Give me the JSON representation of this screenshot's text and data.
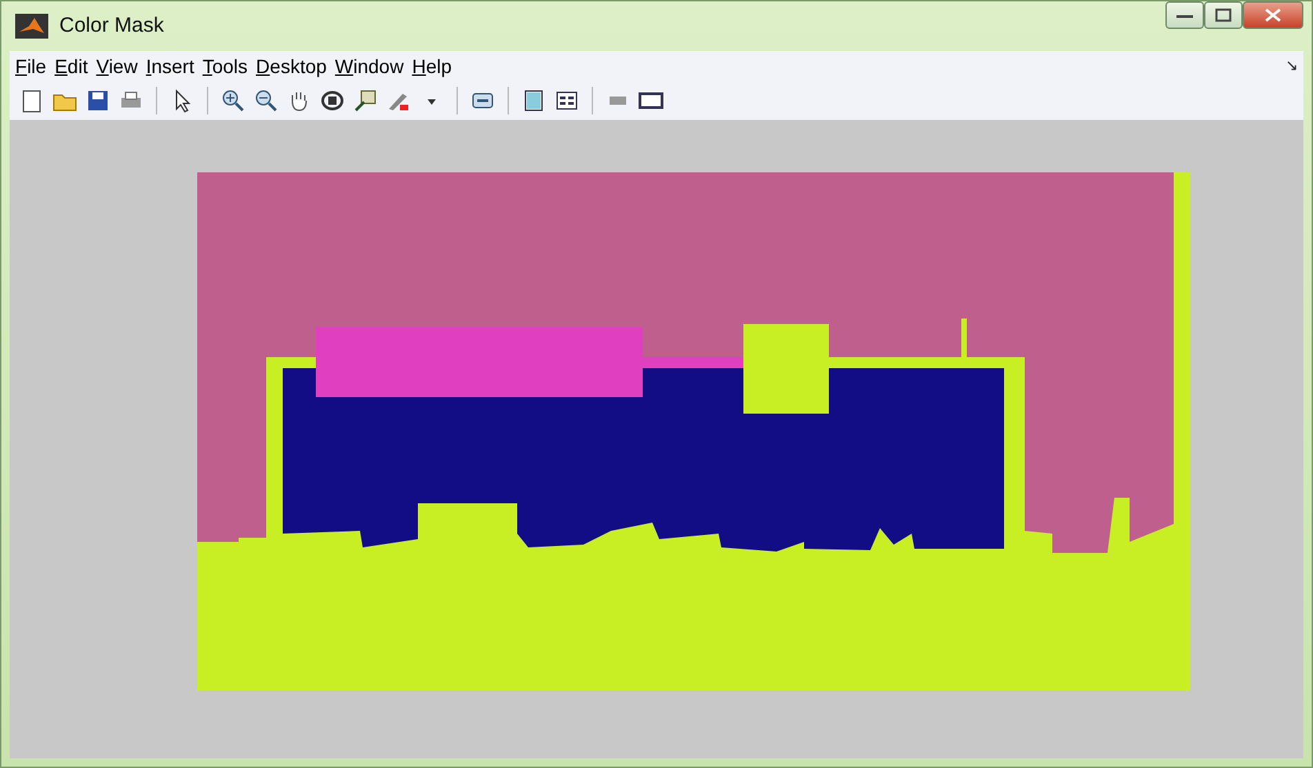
{
  "window": {
    "title": "Color Mask"
  },
  "menu": [
    {
      "label": "File"
    },
    {
      "label": "Edit"
    },
    {
      "label": "View"
    },
    {
      "label": "Insert"
    },
    {
      "label": "Tools"
    },
    {
      "label": "Desktop"
    },
    {
      "label": "Window"
    },
    {
      "label": "Help"
    }
  ],
  "menu_corner_glyph": "↘"
}
